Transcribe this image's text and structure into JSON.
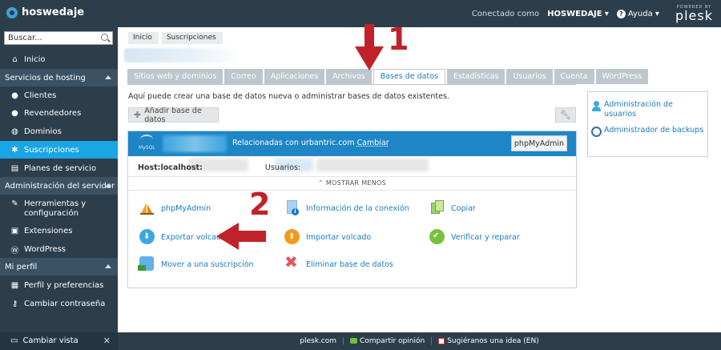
{
  "topbar": {
    "brand": "hoswedaje",
    "connected_as_label": "Conectado como",
    "username": "HOSWEDAJE",
    "help_label": "Ayuda",
    "powered_by": "POWERED BY",
    "plesk": "plesk"
  },
  "sidebar": {
    "search_placeholder": "Buscar...",
    "home": "Inicio",
    "section_hosting": "Servicios de hosting",
    "clients": "Clientes",
    "resellers": "Revendedores",
    "domains": "Dominios",
    "subscriptions": "Suscripciones",
    "service_plans": "Planes de servicio",
    "section_server": "Administración del servidor",
    "tools_line1": "Herramientas y",
    "tools_line2": "configuración",
    "extensions": "Extensiones",
    "wordpress": "WordPress",
    "section_profile": "Mi perfil",
    "profile_prefs": "Perfil y preferencias",
    "change_password": "Cambiar contraseña",
    "change_view": "Cambiar vista"
  },
  "breadcrumb": [
    "Inicio",
    "Suscripciones"
  ],
  "tabs": [
    "Sitios web y dominios",
    "Correo",
    "Aplicaciones",
    "Archivos",
    "Bases de datos",
    "Estadísticas",
    "Usuarios",
    "Cuenta",
    "WordPress"
  ],
  "intro_text": "Aquí puede crear una base de datos nueva o administrar bases de datos existentes.",
  "add_db_label": "Añadir base de datos",
  "db_card": {
    "mysql_label": "MySQL",
    "related_prefix": "Relacionadas con urbantric.com",
    "change_label": "Cambiar",
    "phpmyadmin_button": "phpMyAdmin",
    "host_label": "Host:localhost:",
    "users_label": "Usuarios:",
    "show_less": "MOSTRAR MENOS",
    "actions": {
      "phpmyadmin": "phpMyAdmin",
      "connection_info": "Información de la conexión",
      "copy": "Copiar",
      "export_dump": "Exportar volcado",
      "import_dump": "Importar volcado",
      "check_repair": "Verificar y reparar",
      "move_subscription": "Mover a una suscripción",
      "delete_db": "Eliminar base de datos"
    }
  },
  "side_panel": {
    "user_admin": "Administración de usuarios",
    "backup_manager": "Administrador de backups"
  },
  "footer": {
    "site": "plesk.com",
    "share_opinion": "Compartir opinión",
    "suggest_idea": "Sugiéranos una idea (EN)"
  },
  "annotations": [
    "1",
    "2"
  ],
  "colors": {
    "topbar": "#2c3e4b",
    "accent": "#1aa5e5",
    "db_header": "#1e86c7",
    "link": "#1a7cc0",
    "annotation_red": "#c0222a"
  }
}
